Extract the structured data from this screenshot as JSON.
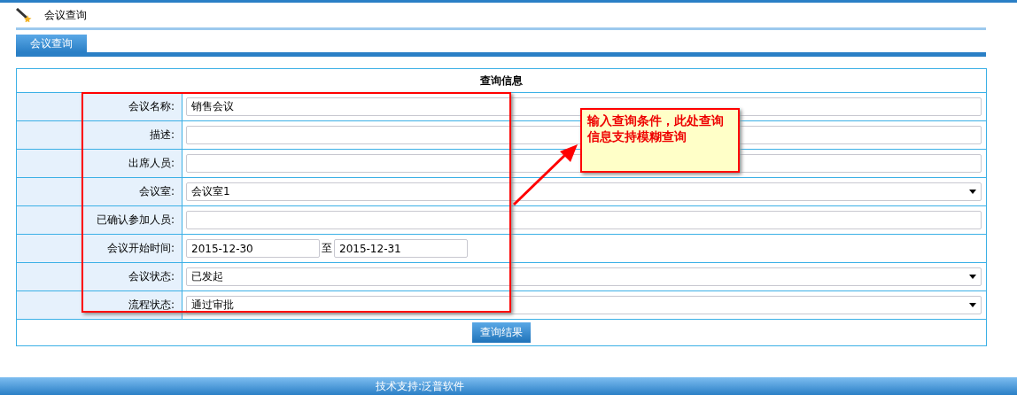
{
  "page_title": "会议查询",
  "tabs": [
    {
      "label": "会议查询",
      "selected": true
    }
  ],
  "form": {
    "title": "查询信息",
    "fields": [
      {
        "kind": "text",
        "label": "会议名称:",
        "value": "销售会议"
      },
      {
        "kind": "text",
        "label": "描述:"
      },
      {
        "kind": "text",
        "label": "出席人员:"
      },
      {
        "kind": "select",
        "label": "会议室:",
        "value": "会议室1"
      },
      {
        "kind": "text",
        "label": "已确认参加人员:"
      },
      {
        "kind": "daterange",
        "label": "会议开始时间:",
        "from": "2015-12-30",
        "separator": "至",
        "to": "2015-12-31"
      },
      {
        "kind": "select",
        "label": "会议状态:",
        "value": "已发起"
      },
      {
        "kind": "select",
        "label": "流程状态:",
        "value": "通过审批"
      }
    ],
    "submit": "查询结果"
  },
  "annotation": {
    "callout": "输入查询条件，此处查询信息支持模糊查询"
  },
  "footer": "技术支持:泛普软件"
}
